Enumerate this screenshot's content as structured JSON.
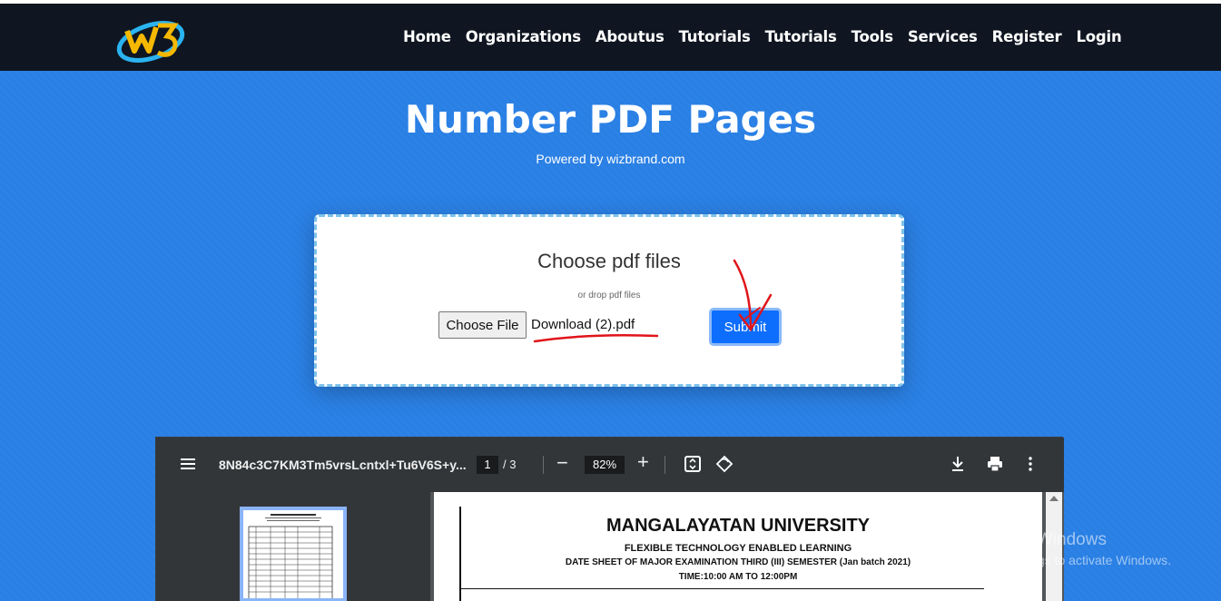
{
  "nav": {
    "items": [
      "Home",
      "Organizations",
      "Aboutus",
      "Tutorials",
      "Tutorials",
      "Tools",
      "Services",
      "Register",
      "Login"
    ]
  },
  "hero": {
    "title": "Number PDF Pages",
    "powered": "Powered by wizbrand.com"
  },
  "upload": {
    "title": "Choose pdf files",
    "subtitle": "or drop pdf files",
    "choose_label": "Choose File",
    "file_name": "Download (2).pdf",
    "submit_label": "Submit"
  },
  "viewer": {
    "file_name": "8N84c3C7KM3Tm5vrsLcntxl+Tu6V6S+y...",
    "current_page": "1",
    "total_pages": "/ 3",
    "zoom": "82%",
    "page_content": {
      "university": "MANGALAYATAN UNIVERSITY",
      "line1": "FLEXIBLE TECHNOLOGY ENABLED LEARNING",
      "line2": "DATE SHEET OF MAJOR EXAMINATION THIRD (III) SEMESTER (Jan batch 2021)",
      "line3": "TIME:10:00 AM TO 12:00PM"
    }
  },
  "watermark": {
    "title": "Activate Windows",
    "subtitle": "Go to Settings to activate Windows."
  },
  "colors": {
    "navbar": "#0f1621",
    "hero": "#2a7fe3",
    "submit": "#0d6efd",
    "viewer_toolbar": "#323639"
  }
}
